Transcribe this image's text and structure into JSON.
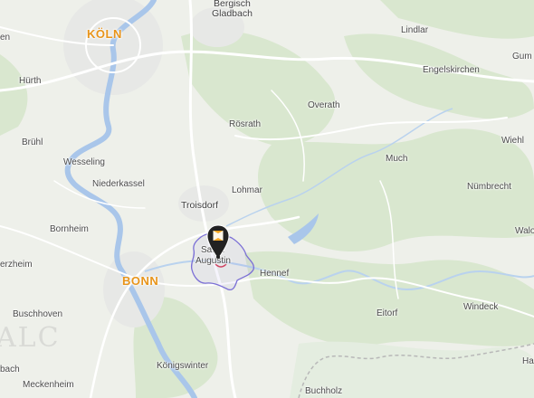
{
  "map": {
    "labels": {
      "koeln": "KÖLN",
      "bonn": "BONN",
      "bergisch": "Bergisch",
      "gladbach": "Gladbach",
      "lindlar": "Lindlar",
      "gum": "Gum",
      "en": "en",
      "huerth": "Hürth",
      "engelskirchen": "Engelskirchen",
      "overath": "Overath",
      "roesrath": "Rösrath",
      "bruehl": "Brühl",
      "wiehl": "Wiehl",
      "wesseling": "Wesseling",
      "much": "Much",
      "niederkassel": "Niederkassel",
      "lohmar": "Lohmar",
      "nuembrecht": "Nümbrecht",
      "troisdorf": "Troisdorf",
      "bornheim": "Bornheim",
      "sankt": "Sankt",
      "augustin": "Augustin",
      "walo": "Walo",
      "erzheim": "erzheim",
      "hennef": "Hennef",
      "buschhoven": "Buschhoven",
      "eitorf": "Eitorf",
      "windeck": "Windeck",
      "ha": "Ha",
      "bach": "bach",
      "koenigswinter": "Königswinter",
      "meckenheim": "Meckenheim",
      "buchholz": "Buchholz"
    },
    "watermark": "ALC",
    "marker": {
      "icon": "building-marker-icon"
    },
    "colors": {
      "land": "#eef0ea",
      "forest": "#d8e6cf",
      "water": "#a9c6ea",
      "road": "#ffffff",
      "city_label": "#e8941a",
      "boundary": "#7b6fd6",
      "pin": "#222222"
    }
  }
}
